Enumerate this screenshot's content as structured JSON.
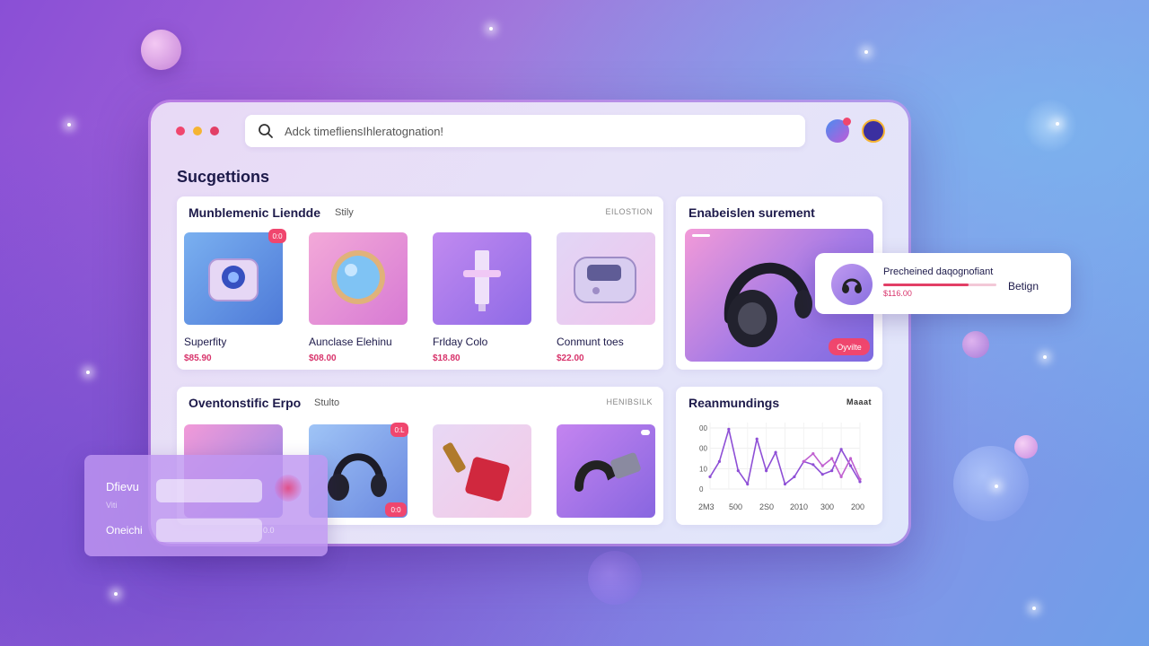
{
  "window": {
    "search": {
      "placeholder": "Adck timefliensIhleratognation!"
    }
  },
  "page_title": "Sucgettions",
  "section1": {
    "title": "Munblemenic Liendde",
    "subtitle": "Stily",
    "tag": "EILOSTION",
    "products": [
      {
        "name": "Superfity",
        "price": "$85.90",
        "badge": "0:0"
      },
      {
        "name": "Aunclase Elehinu",
        "price": "$08.00",
        "badge": ""
      },
      {
        "name": "Frlday Colo",
        "price": "$18.80",
        "badge": ""
      },
      {
        "name": "Conmunt toes",
        "price": "$22.00",
        "badge": ""
      }
    ]
  },
  "feature": {
    "title": "Enabeislen surement",
    "pill": "Oyvilte"
  },
  "float_card": {
    "title": "Precheined daqognofiant",
    "price": "$116.00",
    "action": "Betign",
    "progress": 0.75
  },
  "section2": {
    "title": "Oventonstific Erpo",
    "subtitle": "Stulto",
    "tag": "HENIBSILK",
    "products": [
      {
        "badge": ""
      },
      {
        "badge": "0:L",
        "badge2": "0:0"
      },
      {
        "badge": ""
      },
      {
        "badge": ""
      }
    ]
  },
  "chart_card": {
    "title": "Reanmundings",
    "tag": "Maaat"
  },
  "chart_data": {
    "type": "line",
    "title": "Reanmundings",
    "xlabel": "",
    "ylabel": "",
    "ytick_labels": [
      "0",
      "10",
      "00",
      "00"
    ],
    "xtick_labels": [
      "2M3",
      "500",
      "2S0",
      "2010",
      "300",
      "200"
    ],
    "ylim": [
      0,
      100
    ],
    "series": [
      {
        "color": "#8e4fd6",
        "values": [
          20,
          45,
          98,
          30,
          8,
          82,
          30,
          60,
          8,
          20,
          45,
          40,
          24,
          30,
          65,
          38,
          12
        ]
      },
      {
        "color": "#c060d0",
        "values": [
          null,
          null,
          null,
          null,
          null,
          null,
          null,
          null,
          null,
          null,
          45,
          58,
          38,
          50,
          20,
          50,
          16
        ]
      }
    ]
  },
  "left_panel": {
    "label1": "Dfievu",
    "sub1": "Viti",
    "label2": "Oneichi",
    "hint2": "0.0"
  },
  "colors": {
    "accent": "#f0466e",
    "title": "#1d1a4a",
    "purple": "#8e4fd6"
  }
}
